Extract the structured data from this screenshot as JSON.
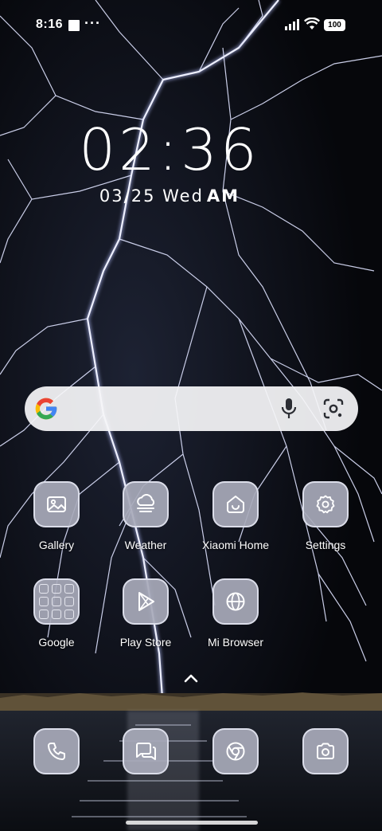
{
  "status_bar": {
    "time": "8:16",
    "more_indicator": "···",
    "battery": "100",
    "icons": [
      "notification-square-icon",
      "signal-icon",
      "wifi-icon",
      "battery-icon"
    ]
  },
  "clock": {
    "time": "02:36",
    "date": "03/25 Wed",
    "ampm": "AM"
  },
  "search_bar": {
    "icons": [
      "google-g-icon",
      "microphone-icon",
      "google-lens-icon"
    ]
  },
  "apps": [
    {
      "label": "Gallery",
      "icon": "gallery-icon"
    },
    {
      "label": "Weather",
      "icon": "weather-icon"
    },
    {
      "label": "Xiaomi Home",
      "icon": "xiaomi-home-icon"
    },
    {
      "label": "Settings",
      "icon": "gear-icon"
    },
    {
      "label": "Google",
      "icon": "google-folder-icon"
    },
    {
      "label": "Play Store",
      "icon": "play-store-icon"
    },
    {
      "label": "Mi Browser",
      "icon": "globe-icon"
    }
  ],
  "dock": [
    {
      "icon": "phone-icon"
    },
    {
      "icon": "messages-icon"
    },
    {
      "icon": "chrome-icon"
    },
    {
      "icon": "camera-icon"
    }
  ],
  "drawer": {
    "icon": "chevron-up-icon"
  },
  "colors": {
    "icon_fill": "#a8aaba",
    "icon_border": "#dee0ec",
    "search_bg": "#f5f5f8",
    "google_blue": "#4285f4",
    "google_red": "#ea4335",
    "google_yellow": "#fbbc05",
    "google_green": "#34a853"
  }
}
